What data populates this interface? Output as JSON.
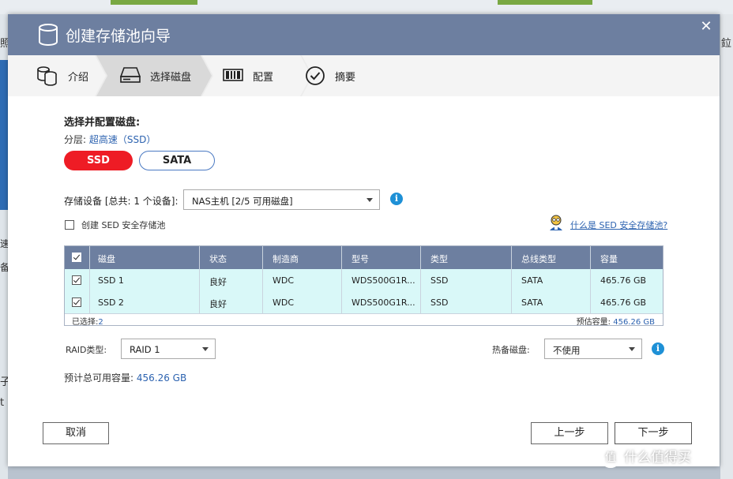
{
  "background": {
    "left_fragments": [
      "照",
      "速",
      "备",
      "子通",
      "t"
    ],
    "right_fragments": [
      "鉝"
    ]
  },
  "dialog": {
    "title": "创建存储池向导",
    "close_icon": "close-icon"
  },
  "steps": [
    {
      "label": "介绍",
      "icon": "database-icon"
    },
    {
      "label": "选择磁盘",
      "icon": "disk-drive-icon"
    },
    {
      "label": "配置",
      "icon": "raid-config-icon"
    },
    {
      "label": "摘要",
      "icon": "check-circle-icon"
    }
  ],
  "form": {
    "heading": "选择并配置磁盘:",
    "tier_label": "分层:",
    "tier_value": "超高速（SSD）",
    "tier_buttons": {
      "ssd": "SSD",
      "sata": "SATA"
    },
    "device_label": "存储设备 [总共: 1 个设备]:",
    "device_select": "NAS主机  [2/5 可用磁盘]",
    "sed_checkbox_label": "创建 SED 安全存储池",
    "sed_help_link": "什么是 SED 安全存储池?"
  },
  "table": {
    "headers": [
      "磁盘",
      "状态",
      "制造商",
      "型号",
      "类型",
      "总线类型",
      "容量"
    ],
    "rows": [
      {
        "disk": "SSD 1",
        "status": "良好",
        "vendor": "WDC",
        "model": "WDS500G1R...",
        "type": "SSD",
        "bus": "SATA",
        "capacity": "465.76 GB",
        "checked": true
      },
      {
        "disk": "SSD 2",
        "status": "良好",
        "vendor": "WDC",
        "model": "WDS500G1R...",
        "type": "SSD",
        "bus": "SATA",
        "capacity": "465.76 GB",
        "checked": true
      }
    ],
    "footer_selected_label": "已选择:",
    "footer_selected_value": "2",
    "footer_capacity_label": "预估容量:",
    "footer_capacity_value": "456.26 GB"
  },
  "raid": {
    "label": "RAID类型:",
    "value": "RAID 1"
  },
  "spare": {
    "label": "热备磁盘:",
    "value": "不使用"
  },
  "capacity": {
    "label": "预计总可用容量:",
    "value": "456.26 GB"
  },
  "buttons": {
    "cancel": "取消",
    "back": "上一步",
    "next": "下一步"
  },
  "watermark": {
    "logo": "值",
    "text": "什么值得买"
  },
  "colors": {
    "titlebar": "#6d7fa0",
    "ssd_button": "#ee1c25",
    "link": "#2d63b0",
    "row_selected": "#d9f8f8",
    "info": "#1e90d6"
  }
}
